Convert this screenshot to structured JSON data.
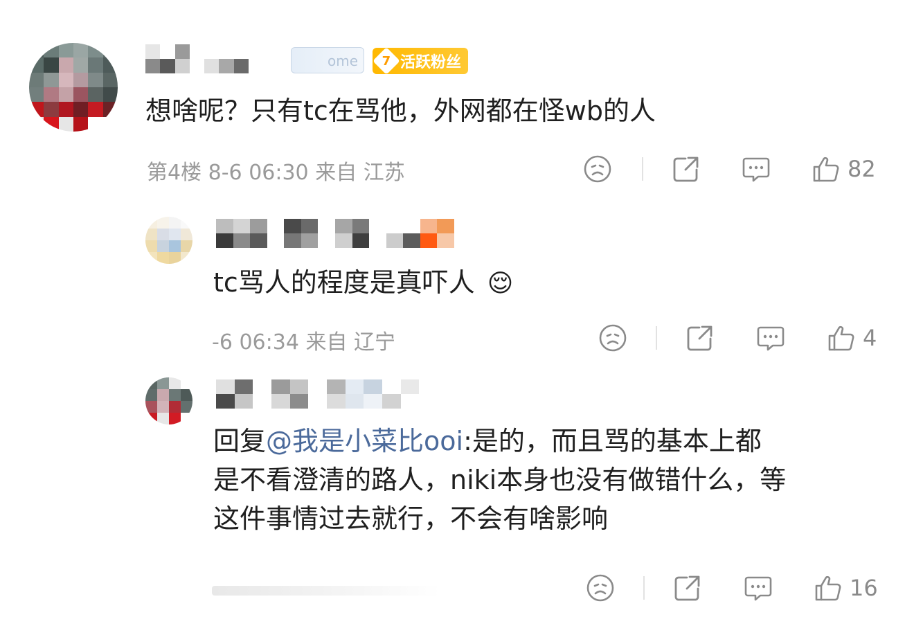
{
  "comment": {
    "badge": {
      "level": "7",
      "label": "活跃粉丝"
    },
    "fan_tag": "ome",
    "content": "想啥呢？只有tc在骂他，外网都在怪wb的人",
    "floor": "第4楼",
    "date": "8-6",
    "time": "06:30",
    "location": "来自 江苏",
    "likes": "82"
  },
  "replies": [
    {
      "content": "tc骂人的程度是真吓人",
      "emoji": "😌",
      "date": "-6",
      "time": "06:34",
      "location": "来自 辽宁",
      "likes": "4"
    },
    {
      "reply_prefix": "回复",
      "mention": "@我是小菜比ooi",
      "content_line1": ":是的，而且骂的基本上都",
      "content_line2": "是不看澄清的路人，niki本身也没有做错什么，等",
      "content_line3": "这件事情过去就行，不会有啥影响",
      "likes": "16"
    }
  ],
  "icons": [
    "dislike-icon",
    "share-icon",
    "comment-icon",
    "like-icon"
  ]
}
